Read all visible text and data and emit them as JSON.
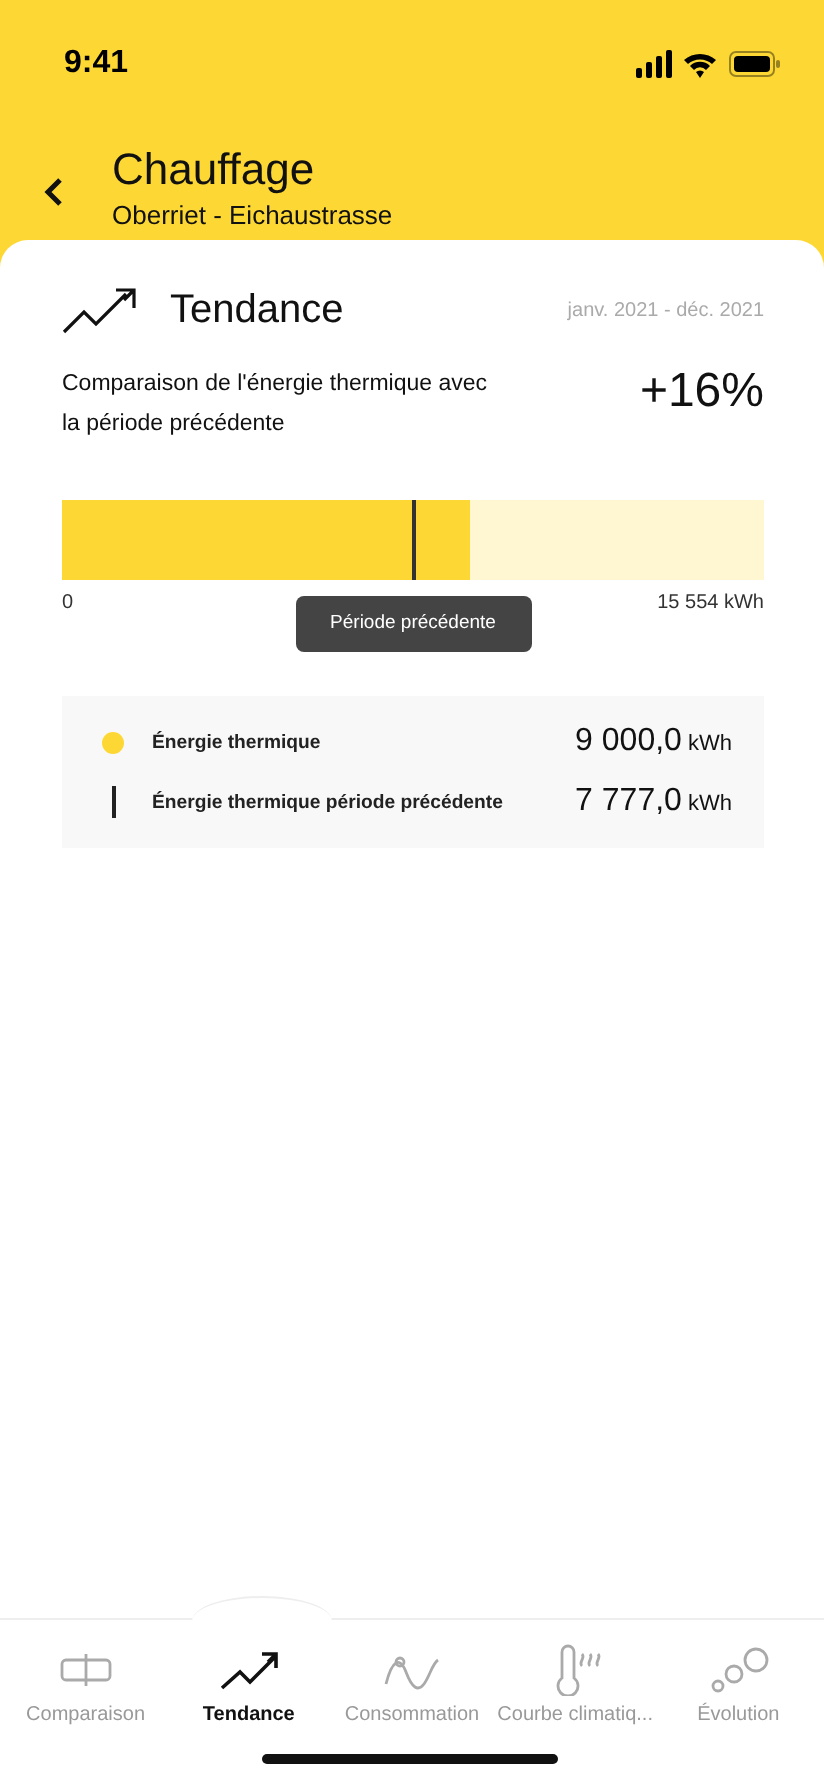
{
  "status_bar": {
    "time": "9:41"
  },
  "header": {
    "title": "Chauffage",
    "subtitle": "Oberriet - Eichaustrasse"
  },
  "card": {
    "title": "Tendance",
    "period": "janv. 2021 - déc. 2021",
    "description": "Comparaison de l'énergie thermique avec la période précédente",
    "change": "+16%",
    "bar": {
      "level": 0.58,
      "marker": {
        "level": 0.5
      },
      "min_label": "0",
      "max_label": "15 554 kWh",
      "tooltip": "Période précédente"
    },
    "legend": [
      {
        "kind": "dot",
        "label": "Énergie thermique",
        "value": "9 000,0",
        "unit": "kWh"
      },
      {
        "kind": "line",
        "label": "Énergie thermique période précédente",
        "value": "7 777,0",
        "unit": "kWh"
      }
    ]
  },
  "tabs": [
    {
      "kind": "compare",
      "label": "Comparaison",
      "selected": false
    },
    {
      "kind": "trend",
      "label": "Tendance",
      "selected": true
    },
    {
      "kind": "wave",
      "label": "Consommation",
      "selected": false
    },
    {
      "kind": "thermo",
      "label": "Courbe climatiq...",
      "selected": false
    },
    {
      "kind": "bubbles",
      "label": "Évolution",
      "selected": false
    }
  ]
}
